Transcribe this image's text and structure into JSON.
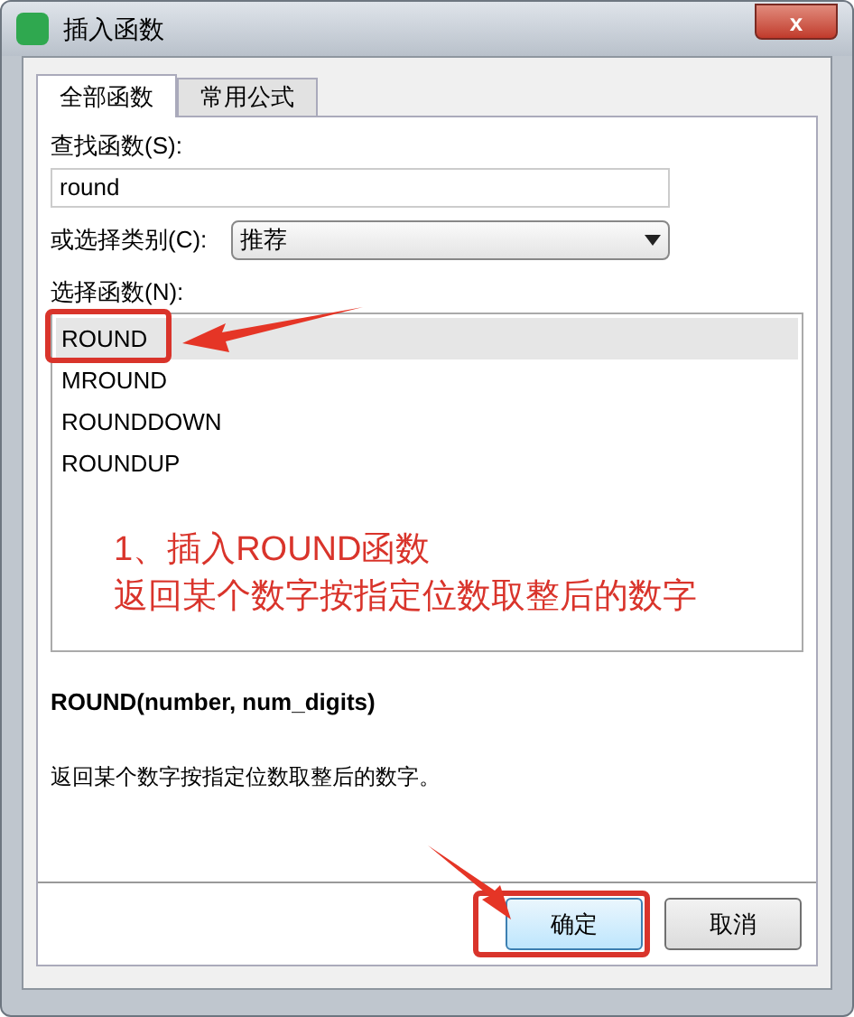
{
  "window": {
    "title": "插入函数",
    "close_glyph": "x"
  },
  "tabs": [
    {
      "label": "全部函数",
      "selected": true
    },
    {
      "label": "常用公式",
      "selected": false
    }
  ],
  "search": {
    "label": "查找函数(S):",
    "value": "round"
  },
  "category": {
    "label": "或选择类别(C):",
    "value": "推荐"
  },
  "functions": {
    "label": "选择函数(N):",
    "items": [
      {
        "name": "ROUND",
        "selected": true
      },
      {
        "name": "MROUND",
        "selected": false
      },
      {
        "name": "ROUNDDOWN",
        "selected": false
      },
      {
        "name": "ROUNDUP",
        "selected": false
      }
    ]
  },
  "annotation": {
    "lines": [
      "1、插入ROUND函数",
      "返回某个数字按指定位数取整后的数字"
    ]
  },
  "signature": "ROUND(number, num_digits)",
  "description": "返回某个数字按指定位数取整后的数字。",
  "buttons": [
    {
      "label": "确定",
      "kind": "primary"
    },
    {
      "label": "取消",
      "kind": "secondary"
    }
  ]
}
